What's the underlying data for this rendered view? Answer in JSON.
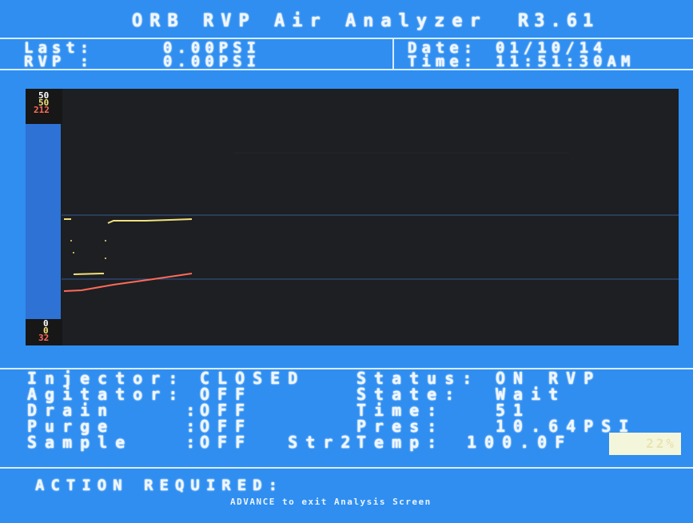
{
  "header": {
    "title": "ORB RVP Air Analyzer",
    "version": "R3.61",
    "last_label": "Last:",
    "last_value": "0.00PSI",
    "rvp_label": "RVP :",
    "rvp_value": "0.00PSI",
    "date_label": "Date:",
    "date_value": "01/10/14",
    "time_label": "Time:",
    "time_value": "11:51:30AM"
  },
  "graph": {
    "scale_top": [
      "50",
      "50",
      "212"
    ],
    "scale_bottom": [
      "0",
      "0",
      "32"
    ],
    "colors": {
      "white": "#eef6ff",
      "yellow": "#f2e27a",
      "red": "#ff6a5a",
      "background": "#1d1f23",
      "gridline": "#3a5f9a"
    }
  },
  "status": {
    "left": [
      {
        "label": "Injector:",
        "value": "CLOSED"
      },
      {
        "label": "Agitator:",
        "value": "OFF"
      },
      {
        "label": "Drain    :",
        "value": "OFF"
      },
      {
        "label": "Purge    :",
        "value": "OFF"
      },
      {
        "label": "Sample   :",
        "value": "OFF  Str2"
      }
    ],
    "right": [
      {
        "label": "Status:",
        "value": "ON RVP"
      },
      {
        "label": "State:",
        "value": "Wait"
      },
      {
        "label": "Time:",
        "value": "51"
      },
      {
        "label": "Pres:",
        "value": "10.64PSI"
      },
      {
        "label": "Temp:",
        "value": "100.0F"
      }
    ],
    "progress_label": "22%",
    "progress_value": 22
  },
  "footer": {
    "action_label": "ACTION REQUIRED:",
    "message": "ADVANCE to exit Analysis Screen"
  }
}
